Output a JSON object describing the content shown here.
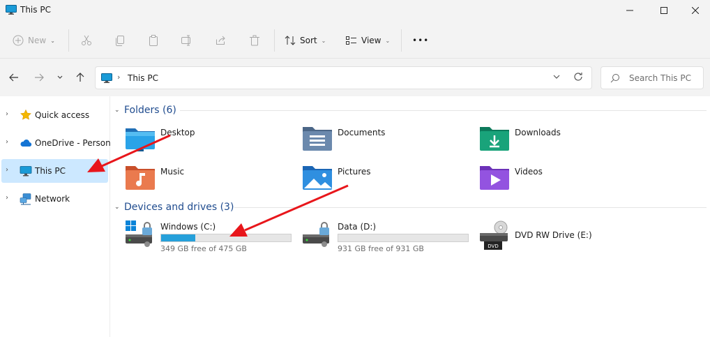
{
  "window": {
    "title": "This PC",
    "controls": [
      "minimize",
      "maximize",
      "close"
    ]
  },
  "toolbar": {
    "new_label": "New",
    "sort_label": "Sort",
    "view_label": "View",
    "more_label": "•••"
  },
  "address": {
    "path_label": "This PC",
    "search_placeholder": "Search This PC"
  },
  "sidebar": {
    "items": [
      {
        "label": "Quick access",
        "icon": "star-icon",
        "selected": false
      },
      {
        "label": "OneDrive - Personal",
        "icon": "cloud-icon",
        "selected": false
      },
      {
        "label": "This PC",
        "icon": "monitor-icon",
        "selected": true
      },
      {
        "label": "Network",
        "icon": "network-icon",
        "selected": false
      }
    ]
  },
  "folders": {
    "title": "Folders (6)",
    "items": [
      {
        "name": "Desktop",
        "icon": "desktop-folder-icon"
      },
      {
        "name": "Documents",
        "icon": "documents-folder-icon"
      },
      {
        "name": "Downloads",
        "icon": "downloads-folder-icon"
      },
      {
        "name": "Music",
        "icon": "music-folder-icon"
      },
      {
        "name": "Pictures",
        "icon": "pictures-folder-icon"
      },
      {
        "name": "Videos",
        "icon": "videos-folder-icon"
      }
    ]
  },
  "drives": {
    "title": "Devices and drives (3)",
    "items": [
      {
        "name": "Windows (C:)",
        "free_text": "349 GB free of 475 GB",
        "used_fraction": 0.265,
        "icon": "windows-drive-icon"
      },
      {
        "name": "Data (D:)",
        "free_text": "931 GB free of 931 GB",
        "used_fraction": 0.0,
        "icon": "data-drive-icon"
      },
      {
        "name": "DVD RW Drive (E:)",
        "icon": "dvd-drive-icon",
        "badge": "DVD"
      }
    ]
  },
  "colors": {
    "accent": "#26a0da",
    "selected_bg": "#cce8ff",
    "group_title": "#1f4b8e",
    "annotation_arrow": "#e8161b"
  }
}
